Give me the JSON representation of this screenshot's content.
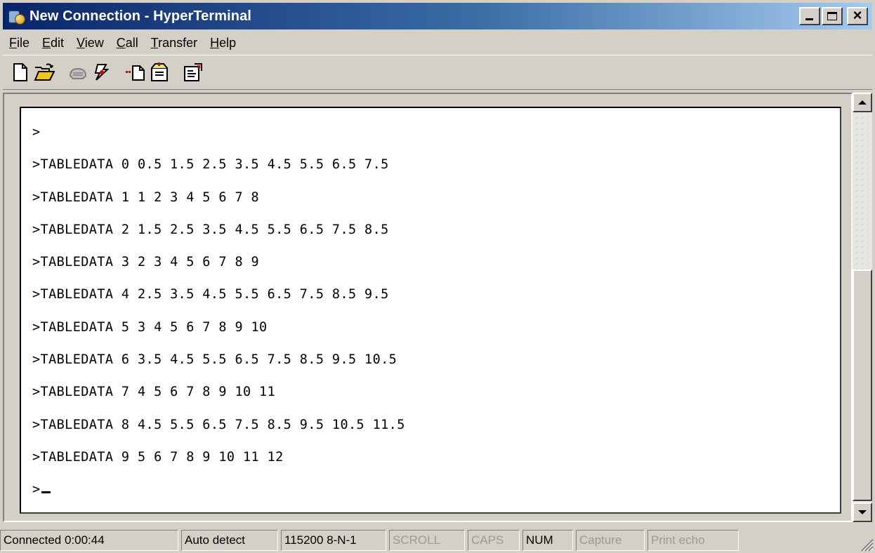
{
  "window": {
    "title": "New Connection - HyperTerminal",
    "buttons": [
      "minimize",
      "maximize",
      "close"
    ]
  },
  "menu": [
    {
      "pre": "",
      "key": "F",
      "post": "ile"
    },
    {
      "pre": "",
      "key": "E",
      "post": "dit"
    },
    {
      "pre": "",
      "key": "V",
      "post": "iew"
    },
    {
      "pre": "",
      "key": "C",
      "post": "all"
    },
    {
      "pre": "",
      "key": "T",
      "post": "ransfer"
    },
    {
      "pre": "",
      "key": "H",
      "post": "elp"
    }
  ],
  "toolbar": {
    "icons": [
      "new-icon",
      "open-icon",
      "call-icon",
      "disconnect-icon",
      "send-icon",
      "receive-icon",
      "properties-icon"
    ]
  },
  "terminal": {
    "lines": [
      ">",
      ">TABLEDATA 0 0.5 1.5 2.5 3.5 4.5 5.5 6.5 7.5",
      ">TABLEDATA 1 1 2 3 4 5 6 7 8",
      ">TABLEDATA 2 1.5 2.5 3.5 4.5 5.5 6.5 7.5 8.5",
      ">TABLEDATA 3 2 3 4 5 6 7 8 9",
      ">TABLEDATA 4 2.5 3.5 4.5 5.5 6.5 7.5 8.5 9.5",
      ">TABLEDATA 5 3 4 5 6 7 8 9 10",
      ">TABLEDATA 6 3.5 4.5 5.5 6.5 7.5 8.5 9.5 10.5",
      ">TABLEDATA 7 4 5 6 7 8 9 10 11",
      ">TABLEDATA 8 4.5 5.5 6.5 7.5 8.5 9.5 10.5 11.5",
      ">TABLEDATA 9 5 6 7 8 9 10 11 12"
    ],
    "prompt": ">"
  },
  "status": {
    "connected": "Connected 0:00:44",
    "detect": "Auto detect",
    "port": "115200 8-N-1",
    "scroll": "SCROLL",
    "caps": "CAPS",
    "num": "NUM",
    "capture": "Capture",
    "print_echo": "Print echo"
  }
}
